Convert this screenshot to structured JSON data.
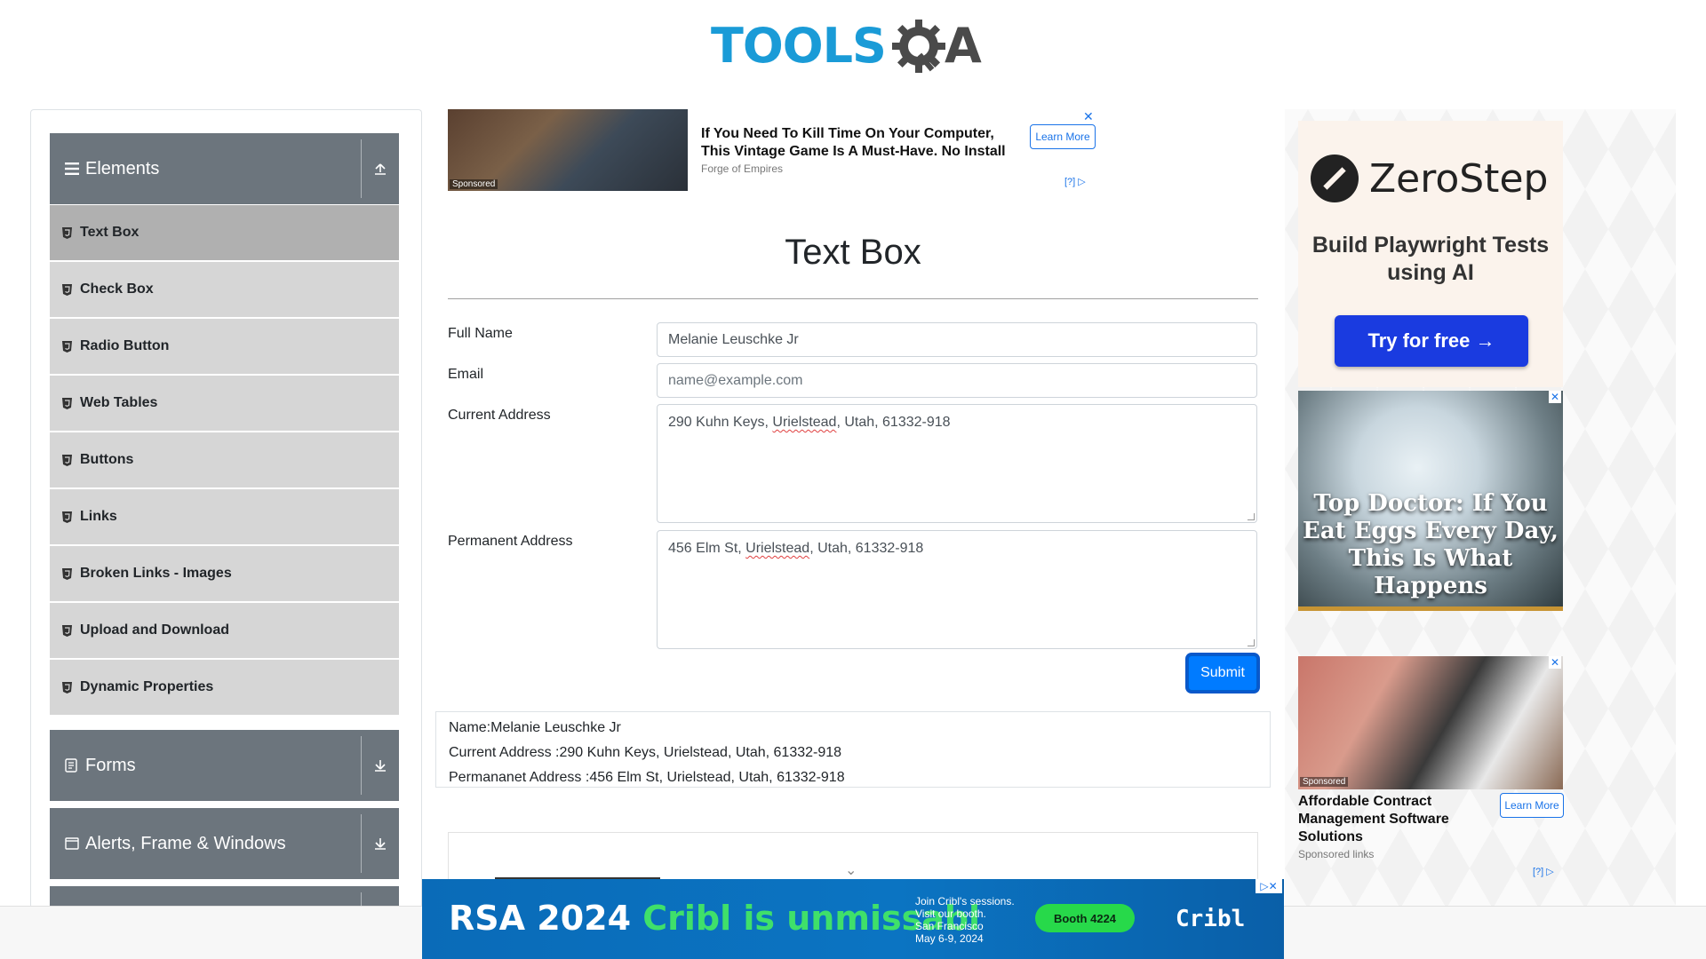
{
  "header": {
    "logo_part1": "TOOLS",
    "logo_part2": "A"
  },
  "sidebar": {
    "groups": [
      {
        "label": "Elements",
        "icon": "hamburger-icon",
        "toggle_icon": "collapse-up-icon"
      },
      {
        "label": "Forms",
        "icon": "document-icon",
        "toggle_icon": "expand-down-icon"
      },
      {
        "label": "Alerts, Frame & Windows",
        "icon": "window-icon",
        "toggle_icon": "expand-down-icon"
      }
    ],
    "items": [
      {
        "label": "Text Box",
        "active": true
      },
      {
        "label": "Check Box"
      },
      {
        "label": "Radio Button"
      },
      {
        "label": "Web Tables"
      },
      {
        "label": "Buttons"
      },
      {
        "label": "Links"
      },
      {
        "label": "Broken Links - Images"
      },
      {
        "label": "Upload and Download"
      },
      {
        "label": "Dynamic Properties"
      }
    ]
  },
  "top_ad": {
    "sponsored": "Sponsored",
    "title": "If You Need To Kill Time On Your Computer, This Vintage Game Is A Must-Have. No Install",
    "source": "Forge of Empires",
    "learn_more": "Learn More",
    "info": "[?]",
    "close": "✕"
  },
  "main": {
    "title": "Text Box",
    "fields": {
      "full_name": {
        "label": "Full Name",
        "value": "Melanie Leuschke Jr"
      },
      "email": {
        "label": "Email",
        "placeholder": "name@example.com"
      },
      "current_address": {
        "label": "Current Address",
        "value_pre": "290 Kuhn Keys, ",
        "value_word": "Urielstead",
        "value_post": ", Utah, 61332-918"
      },
      "permanent_address": {
        "label": "Permanent Address",
        "value_pre": "456 Elm St, ",
        "value_word": "Urielstead",
        "value_post": ", Utah, 61332-918"
      }
    },
    "submit_label": "Submit",
    "output": {
      "name": "Name:Melanie Leuschke Jr",
      "current": "Current Address :290 Kuhn Keys, Urielstead, Utah, 61332-918",
      "permanent": "Permananet Address :456 Elm St, Urielstead, Utah, 61332-918"
    }
  },
  "right_ads": {
    "zerostep": {
      "name": "ZeroStep",
      "tagline": "Build Playwright Tests using AI",
      "cta": "Try for free →"
    },
    "eggs": {
      "headline": "Top Doctor: If You Eat Eggs Every Day, This Is What Happens",
      "close": "✕"
    },
    "contract": {
      "sponsored": "Sponsored",
      "title": "Affordable Contract Management Software Solutions",
      "source": "Sponsored links",
      "learn_more": "Learn More",
      "info": "[?]",
      "close": "✕"
    }
  },
  "bottom_ad": {
    "title_part1": "RSA 2024 ",
    "title_part2": "Cribl is unmissabl",
    "sub_line1": "Join Cribl's sessions.",
    "sub_line2": "Visit our booth.",
    "sub_line3": "San Francisco",
    "sub_line4": "May 6-9, 2024",
    "booth": "Booth 4224",
    "brand": "Cribl",
    "close": "▷✕"
  },
  "colors": {
    "brand_blue": "#1a9bd7",
    "sidebar_header": "#6c757d",
    "menu_item_bg": "#d6d6d6",
    "submit": "#007bff"
  }
}
